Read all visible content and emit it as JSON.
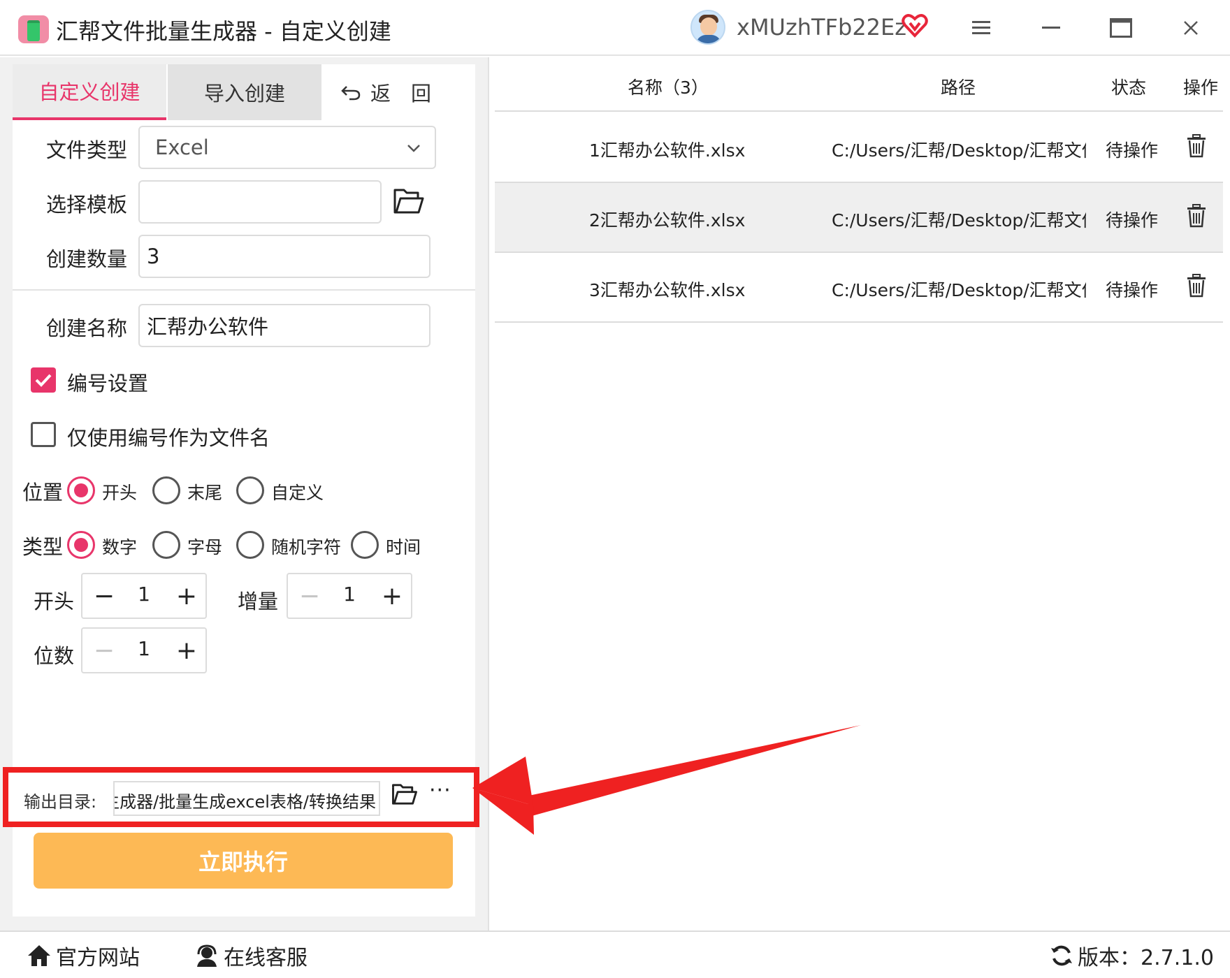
{
  "window": {
    "title": "汇帮文件批量生成器 - 自定义创建",
    "username": "xMUzhTFb22Ez"
  },
  "tabs": {
    "custom": "自定义创建",
    "import": "导入创建",
    "back": "返　回"
  },
  "form": {
    "file_type_label": "文件类型",
    "file_type_value": "Excel",
    "template_label": "选择模板",
    "template_value": "",
    "count_label": "创建数量",
    "count_value": "3",
    "name_label": "创建名称",
    "name_value": "汇帮办公软件"
  },
  "numbering": {
    "enable_label": "编号设置",
    "enable_checked": true,
    "only_number_label": "仅使用编号作为文件名",
    "only_number_checked": false,
    "position_label": "位置",
    "position_options": [
      "开头",
      "末尾",
      "自定义"
    ],
    "position_selected": "开头",
    "type_label": "类型",
    "type_options": [
      "数字",
      "字母",
      "随机字符",
      "时间"
    ],
    "type_selected": "数字",
    "start_label": "开头",
    "start_value": "1",
    "increment_label": "增量",
    "increment_value": "1",
    "digits_label": "位数",
    "digits_value": "1"
  },
  "output": {
    "label": "输出目录:",
    "path": "C:/Users/汇帮/Desktop/汇帮文件批量生成器/批量生成excel表格/转换结果",
    "more": "···"
  },
  "run_button": "立即执行",
  "table": {
    "headers": {
      "name": "名称（3）",
      "path": "路径",
      "status": "状态",
      "operation": "操作"
    },
    "rows": [
      {
        "name": "1汇帮办公软件.xlsx",
        "path": "C:/Users/汇帮/Desktop/汇帮文件",
        "status": "待操作"
      },
      {
        "name": "2汇帮办公软件.xlsx",
        "path": "C:/Users/汇帮/Desktop/汇帮文件",
        "status": "待操作"
      },
      {
        "name": "3汇帮办公软件.xlsx",
        "path": "C:/Users/汇帮/Desktop/汇帮文件",
        "status": "待操作"
      }
    ]
  },
  "footer": {
    "official_site": "官方网站",
    "online_service": "在线客服",
    "version": "版本：2.7.1.0"
  },
  "colors": {
    "accent": "#e8356a",
    "run_button": "#fdb955",
    "annotation": "#ef2121"
  },
  "icons": [
    "app-icon",
    "avatar",
    "vip-heart-icon",
    "menu-icon",
    "minimize-icon",
    "maximize-icon",
    "close-icon",
    "back-arrow-icon",
    "chevron-down-icon",
    "folder-icon",
    "trash-icon",
    "home-icon",
    "headset-icon",
    "refresh-icon"
  ]
}
